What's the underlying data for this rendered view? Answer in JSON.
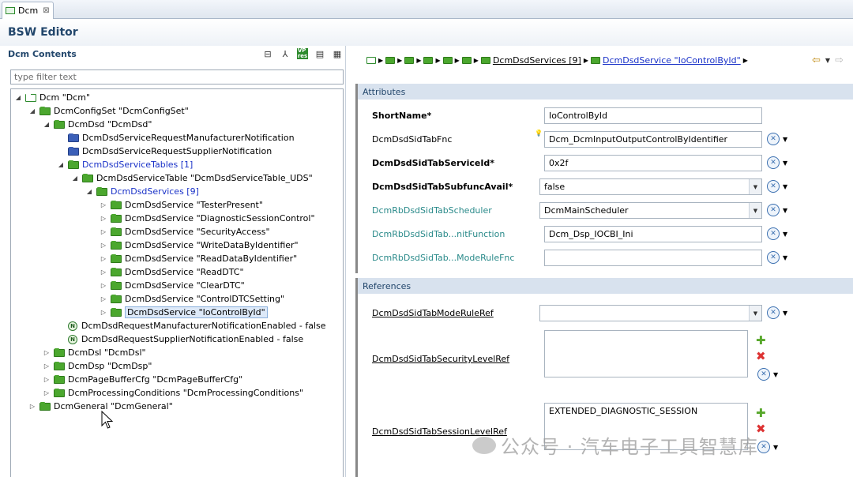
{
  "tab": {
    "label": "Dcm",
    "close": "⊠"
  },
  "editor": {
    "title": "BSW Editor"
  },
  "left": {
    "header": "Dcm Contents",
    "filter_placeholder": "type filter text",
    "tree": [
      {
        "label": "Dcm \"Dcm\"",
        "depth": 0,
        "twisty": "◢",
        "icon": "white"
      },
      {
        "label": "DcmConfigSet \"DcmConfigSet\"",
        "depth": 1,
        "twisty": "◢",
        "icon": "green"
      },
      {
        "label": "DcmDsd \"DcmDsd\"",
        "depth": 2,
        "twisty": "◢",
        "icon": "green"
      },
      {
        "label": "DcmDsdServiceRequestManufacturerNotification",
        "depth": 3,
        "twisty": "",
        "icon": "blue"
      },
      {
        "label": "DcmDsdServiceRequestSupplierNotification",
        "depth": 3,
        "twisty": "",
        "icon": "blue"
      },
      {
        "label": "DcmDsdServiceTables [1]",
        "depth": 3,
        "twisty": "◢",
        "icon": "green",
        "link": true
      },
      {
        "label": "DcmDsdServiceTable \"DcmDsdServiceTable_UDS\"",
        "depth": 4,
        "twisty": "◢",
        "icon": "green"
      },
      {
        "label": "DcmDsdServices [9]",
        "depth": 5,
        "twisty": "◢",
        "icon": "green",
        "link": true
      },
      {
        "label": "DcmDsdService \"TesterPresent\"",
        "depth": 6,
        "twisty": "▷",
        "icon": "green"
      },
      {
        "label": "DcmDsdService \"DiagnosticSessionControl\"",
        "depth": 6,
        "twisty": "▷",
        "icon": "green"
      },
      {
        "label": "DcmDsdService \"SecurityAccess\"",
        "depth": 6,
        "twisty": "▷",
        "icon": "green"
      },
      {
        "label": "DcmDsdService \"WriteDataByIdentifier\"",
        "depth": 6,
        "twisty": "▷",
        "icon": "green"
      },
      {
        "label": "DcmDsdService \"ReadDataByIdentifier\"",
        "depth": 6,
        "twisty": "▷",
        "icon": "green"
      },
      {
        "label": "DcmDsdService \"ReadDTC\"",
        "depth": 6,
        "twisty": "▷",
        "icon": "green"
      },
      {
        "label": "DcmDsdService \"ClearDTC\"",
        "depth": 6,
        "twisty": "▷",
        "icon": "green"
      },
      {
        "label": "DcmDsdService \"ControlDTCSetting\"",
        "depth": 6,
        "twisty": "▷",
        "icon": "green"
      },
      {
        "label": "DcmDsdService \"IoControlById\"",
        "depth": 6,
        "twisty": "▷",
        "icon": "green",
        "selected": true
      },
      {
        "label": "DcmDsdRequestManufacturerNotificationEnabled - false",
        "depth": 3,
        "twisty": "",
        "icon": "n"
      },
      {
        "label": "DcmDsdRequestSupplierNotificationEnabled - false",
        "depth": 3,
        "twisty": "",
        "icon": "n"
      },
      {
        "label": "DcmDsl \"DcmDsl\"",
        "depth": 2,
        "twisty": "▷",
        "icon": "green"
      },
      {
        "label": "DcmDsp \"DcmDsp\"",
        "depth": 2,
        "twisty": "▷",
        "icon": "green"
      },
      {
        "label": "DcmPageBufferCfg \"DcmPageBufferCfg\"",
        "depth": 2,
        "twisty": "▷",
        "icon": "green"
      },
      {
        "label": "DcmProcessingConditions \"DcmProcessingConditions\"",
        "depth": 2,
        "twisty": "▷",
        "icon": "green"
      },
      {
        "label": "DcmGeneral \"DcmGeneral\"",
        "depth": 1,
        "twisty": "▷",
        "icon": "green"
      }
    ]
  },
  "breadcrumb": {
    "services": "DcmDsdServices [9]",
    "current": "DcmDsdService \"IoControlById\""
  },
  "attributes": {
    "header": "Attributes",
    "fields": [
      {
        "label": "ShortName*",
        "value": "IoControlById",
        "style": "b",
        "kind": "text",
        "actions": false
      },
      {
        "label": "DcmDsdSidTabFnc",
        "value": "Dcm_DcmInputOutputControlByIdentifier",
        "style": "",
        "kind": "text",
        "actions": true,
        "bulb": true
      },
      {
        "label": "DcmDsdSidTabServiceId*",
        "value": "0x2f",
        "style": "b",
        "kind": "text",
        "actions": true
      },
      {
        "label": "DcmDsdSidTabSubfuncAvail*",
        "value": "false",
        "style": "b",
        "kind": "combo",
        "actions": true
      },
      {
        "label": "DcmRbDsdSidTabScheduler",
        "value": "DcmMainScheduler",
        "style": "teal",
        "kind": "combo",
        "actions": true
      },
      {
        "label": "DcmRbDsdSidTab...nitFunction",
        "value": "Dcm_Dsp_IOCBI_Ini",
        "style": "teal",
        "kind": "text",
        "actions": true
      },
      {
        "label": "DcmRbDsdSidTab...ModeRuleFnc",
        "value": "",
        "style": "teal",
        "kind": "text",
        "actions": true
      }
    ]
  },
  "references": {
    "header": "References",
    "mode_rule_ref": {
      "label": "DcmDsdSidTabModeRuleRef",
      "value": ""
    },
    "security_level_ref": {
      "label": "DcmDsdSidTabSecurityLevelRef",
      "value": ""
    },
    "session_level_ref": {
      "label": "DcmDsdSidTabSessionLevelRef",
      "value": "EXTENDED_DIAGNOSTIC_SESSION"
    }
  },
  "watermark": "公众号 · 汽车电子工具智慧库",
  "colors": {
    "accent": "#23476c",
    "link": "#1a32c8",
    "folder": "#4ba72e",
    "teal_label": "#2a8a8a"
  }
}
